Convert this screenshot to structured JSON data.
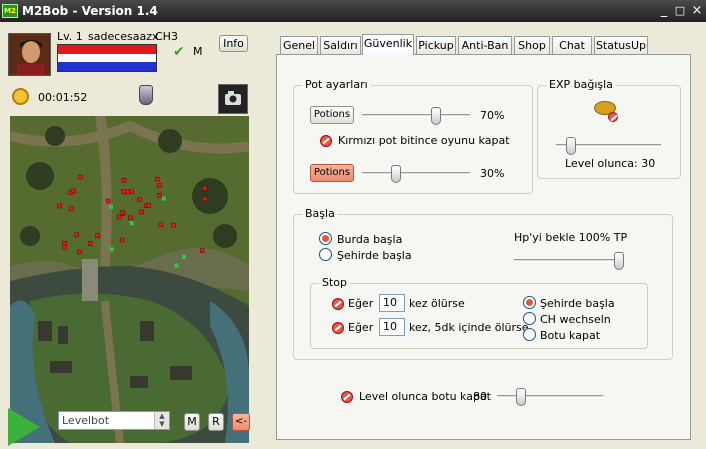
{
  "window": {
    "title": "M2Bob - Version 1.4",
    "logo_text": "M2",
    "controls": [
      "_",
      "□",
      "×"
    ]
  },
  "character": {
    "level_text": "Lv. 1",
    "name": "sadecesaazx",
    "channel": "CH3",
    "flag": "M",
    "info_label": "Info",
    "timer": "00:01:52",
    "bar_colors": [
      "#e11b1b",
      "#ffffff",
      "#2233cc"
    ]
  },
  "map": {
    "red_markers": 33,
    "green_markers": 6
  },
  "bottom": {
    "mode_value": "Levelbot",
    "buttons": [
      "M",
      "R",
      "<-"
    ]
  },
  "tabs": [
    "Genel",
    "Saldırı",
    "Güvenlik",
    "Pickup",
    "Anti-Ban",
    "Shop",
    "Chat",
    "StatusUp"
  ],
  "active_tab": "Güvenlik",
  "pot": {
    "group_title": "Pot ayarları",
    "hp_label": "Potions",
    "hp_percent": 70,
    "hp_percent_text": "70%",
    "close_label": "Kırmızı pot bitince oyunu kapat",
    "mp_label": "Potions",
    "mp_percent": 30,
    "mp_percent_text": "30%"
  },
  "exp": {
    "group_title": "EXP bağışla",
    "level_label": "Level olunca: 30",
    "level_fraction": 0.1
  },
  "start": {
    "group_title": "Başla",
    "radio_here": "Burda başla",
    "radio_town": "Şehirde başla",
    "hp_wait_label": "Hp'yi bekle  100% TP",
    "hp_wait_fraction": 1.0
  },
  "stop": {
    "group_title": "Stop",
    "if1": "Eğer",
    "count1": "10",
    "after1": "kez ölürse",
    "if2": "Eğer",
    "count2": "10",
    "after2": "kez, 5dk içinde ölürse",
    "opt_town": "Şehirde başla",
    "opt_ch": "CH wechseln",
    "opt_close": "Botu kapat"
  },
  "level_close": {
    "label": "Level olunca botu kapat",
    "value": "80",
    "fraction": 0.2
  },
  "colors": {
    "titlebar": "#333333",
    "panel_bg": "#f6f6f3",
    "red_button": "#ee8c70",
    "accent_green": "#3aa13a"
  }
}
